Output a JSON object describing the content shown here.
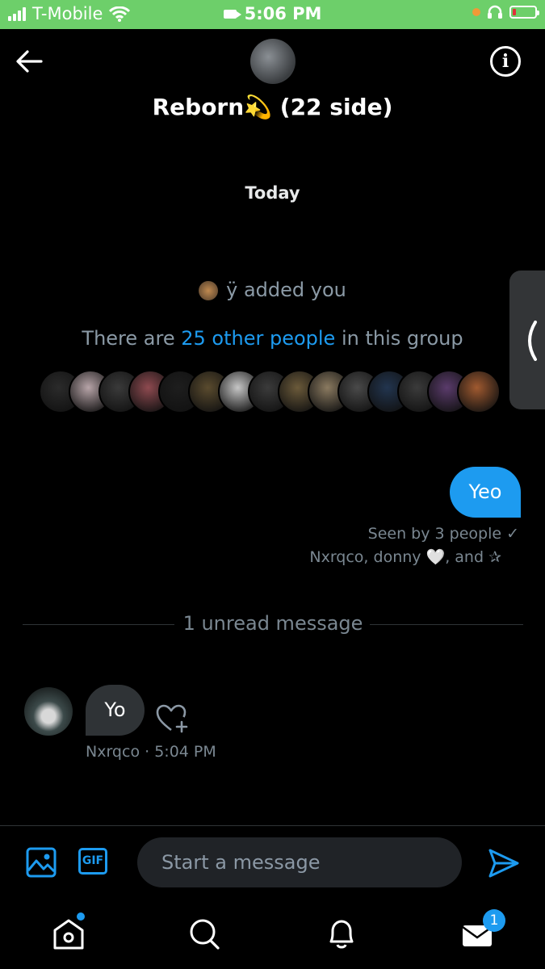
{
  "status_bar": {
    "carrier": "T-Mobile",
    "time": "5:06 PM",
    "battery_level": 0.15
  },
  "header": {
    "title": "Reborn💫 (22 side)"
  },
  "conversation": {
    "date_label": "Today",
    "added_text": "ÿ added you",
    "others_prefix": "There are ",
    "others_link": "25 other people",
    "others_suffix": " in this group",
    "member_avatar_colors": [
      "#2b2b2b",
      "#b7a4a8",
      "#3a3a3a",
      "#8e4a50",
      "#1e1e1e",
      "#5a4b2e",
      "#c6c6c6",
      "#3b3b3b",
      "#6b5a3a",
      "#8a7a60",
      "#4a4a4a",
      "#22354f",
      "#3b3b3b",
      "#5a3b6b",
      "#a05a30"
    ],
    "outgoing": {
      "text": "Yeo",
      "seen": "Seen by 3 people ✓",
      "seen_names": "Nxrqco, donny 🤍, and ✰"
    },
    "unread_divider": "1 unread message",
    "incoming": {
      "text": "Yo",
      "sender": "Nxrqco",
      "time": "· 5:04 PM"
    }
  },
  "composer": {
    "gif_label": "GIF",
    "placeholder": "Start a message"
  },
  "tabbar": {
    "messages_badge": "1"
  },
  "colors": {
    "accent": "#1d9bf0",
    "background": "#000000",
    "status_bar": "#6dcf6a"
  }
}
